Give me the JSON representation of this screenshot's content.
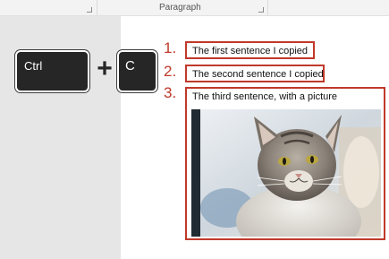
{
  "ribbon": {
    "group_label": "Paragraph"
  },
  "keys": {
    "ctrl_label": "Ctrl",
    "plus_label": "+",
    "c_label": "C"
  },
  "items": [
    {
      "number": "1.",
      "text": "The first sentence I copied"
    },
    {
      "number": "2.",
      "text": "The second sentence I copied"
    },
    {
      "number": "3.",
      "text": "The third sentence, with a picture"
    }
  ],
  "picture": {
    "icon": "cat-photo"
  },
  "colors": {
    "accent_red": "#c0392b",
    "key_bg": "#262626",
    "pane_gray": "#e6e6e6"
  }
}
